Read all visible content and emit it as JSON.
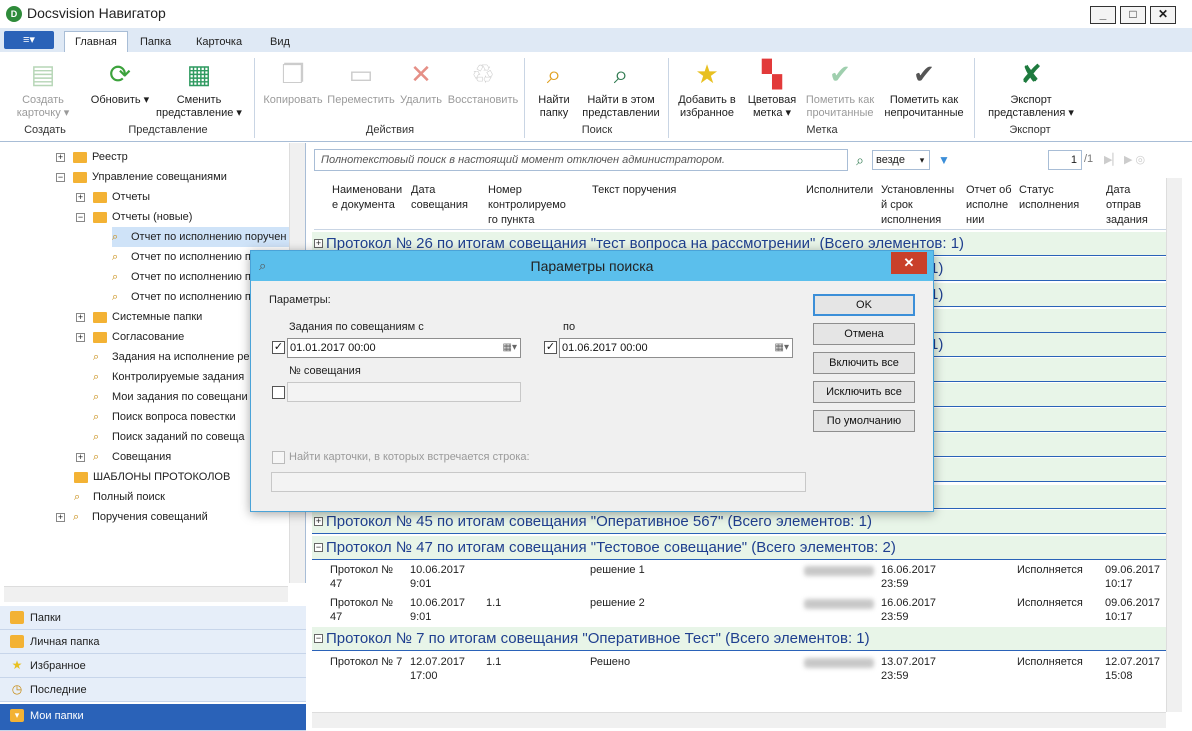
{
  "window": {
    "title": "Docsvision Навигатор",
    "min": "_",
    "max": "□",
    "close": "✕"
  },
  "ribbon": {
    "menu_label": "≡▾",
    "tabs": [
      "Главная",
      "Папка",
      "Карточка",
      "Вид"
    ],
    "buttons": {
      "create": "Создать карточку ▾",
      "refresh": "Обновить ▾",
      "change_view": "Сменить представление ▾",
      "copy": "Копировать",
      "move": "Переместить",
      "delete": "Удалить",
      "restore": "Восстановить",
      "find_folder": "Найти папку",
      "find_in_view": "Найти в этом представлении",
      "add_fav": "Добавить в избранное",
      "color_mark": "Цветовая метка ▾",
      "mark_read": "Пометить как прочитанные",
      "mark_unread": "Пометить как непрочитанные",
      "export": "Экспорт представления ▾"
    },
    "groups": {
      "create": "Создать",
      "view": "Представление",
      "actions": "Действия",
      "search": "Поиск",
      "mark": "Метка",
      "export": "Экспорт"
    }
  },
  "tree": {
    "items": [
      "Реестр",
      "Управление совещаниями",
      "Отчеты",
      "Отчеты (новые)",
      "Отчет по исполнению поручен",
      "Отчет по исполнению п",
      "Отчет по исполнению п",
      "Отчет по исполнению п",
      "Системные папки",
      "Согласование",
      "Задания на исполнение ре",
      "Контролируемые задания",
      "Мои задания по совещани",
      "Поиск вопроса повестки",
      "Поиск заданий по совеща",
      "Совещания",
      "ШАБЛОНЫ ПРОТОКОЛОВ",
      "Полный поиск",
      "Поручения совещаний"
    ]
  },
  "nav": {
    "items": [
      "Папки",
      "Личная папка",
      "Избранное",
      "Последние",
      "Мои папки"
    ]
  },
  "search": {
    "placeholder": "Полнотекстовый поиск в настоящий момент отключен администратором.",
    "scope": "везде",
    "page": "1",
    "page_total": "/1"
  },
  "grid": {
    "headers": [
      "Наименовани е документа",
      "Дата совещания",
      "Номер контролируемо го пункта",
      "Текст поручения",
      "Исполнители",
      "Установленны й срок исполнения",
      "Отчет об исполне нии",
      "Статус исполнения",
      "Дата отправ задания"
    ],
    "groups": [
      "Протокол № 26 по итогам совещания \"тест вопроса на рассмотрении\" (Всего элементов: 1)",
      "1)",
      "1)",
      "1)",
      "Протокол № 45 по итогам совещания \"Оперативное 567\" (Всего элементов: 1)",
      "Протокол № 47 по итогам совещания \"Тестовое совещание\" (Всего элементов: 2)",
      "Протокол № 7 по итогам совещания \"Оперативное Тест\" (Всего элементов: 1)"
    ],
    "rows": [
      {
        "doc": "Протокол № 47",
        "date": "10.06.2017 9:01",
        "num": "",
        "text": "решение 1",
        "due": "16.06.2017 23:59",
        "status": "Исполняется",
        "sent": "09.06.2017 10:17"
      },
      {
        "doc": "Протокол № 47",
        "date": "10.06.2017 9:01",
        "num": "1.1",
        "text": "решение 2",
        "due": "16.06.2017 23:59",
        "status": "Исполняется",
        "sent": "09.06.2017 10:17"
      },
      {
        "doc": "Протокол № 7",
        "date": "12.07.2017 17:00",
        "num": "1.1",
        "text": "Решено",
        "due": "13.07.2017 23:59",
        "status": "Исполняется",
        "sent": "12.07.2017 15:08"
      }
    ]
  },
  "dialog": {
    "title": "Параметры поиска",
    "params_label": "Параметры:",
    "from_label": "Задания по совещаниям с",
    "to_label": "по",
    "from_value": "01.01.2017 00:00",
    "to_value": "01.06.2017 00:00",
    "number_label": "№ совещания",
    "find_cards_label": "Найти карточки, в которых встречается строка:",
    "ok": "OK",
    "cancel": "Отмена",
    "include_all": "Включить все",
    "exclude_all": "Исключить все",
    "default": "По умолчанию"
  }
}
